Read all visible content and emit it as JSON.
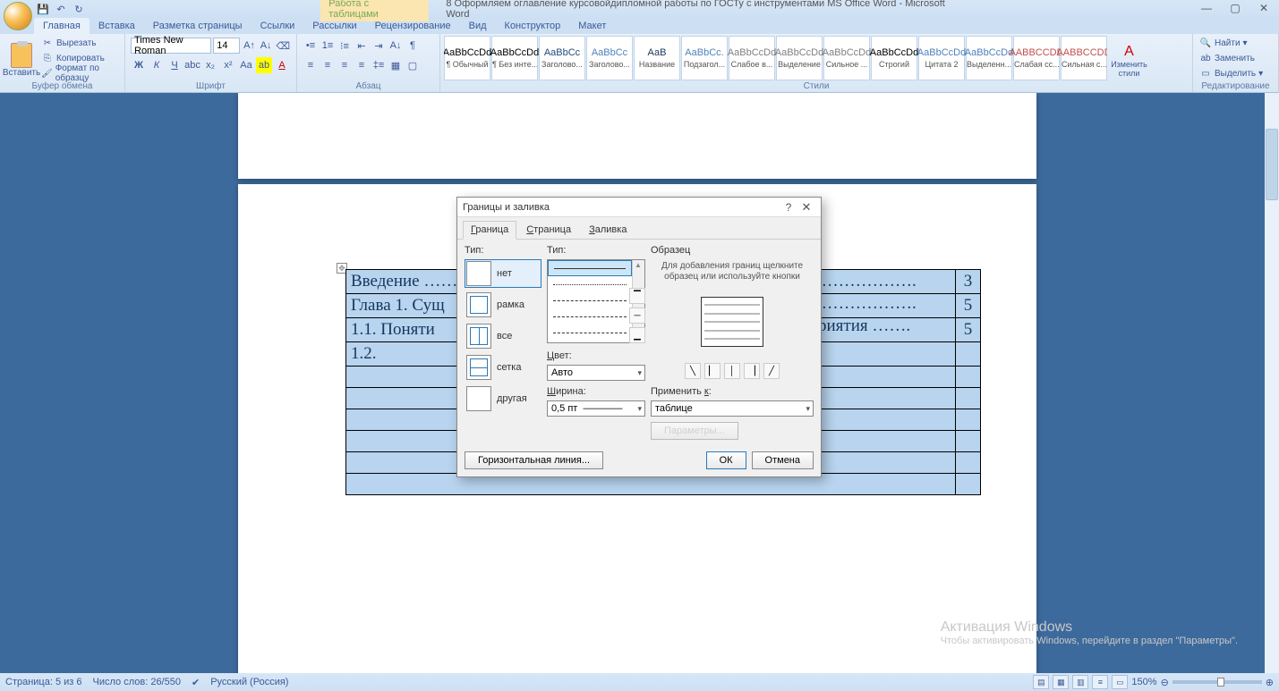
{
  "window": {
    "context_tab": "Работа с таблицами",
    "doc_title": "8 Оформляем оглавление курсовойдипломной работы по ГОСТу с инструментами MS Office Word - Microsoft Word"
  },
  "tabs": {
    "home": "Главная",
    "insert": "Вставка",
    "layout": "Разметка страницы",
    "refs": "Ссылки",
    "mail": "Рассылки",
    "review": "Рецензирование",
    "view": "Вид",
    "design": "Конструктор",
    "table_layout": "Макет"
  },
  "ribbon": {
    "paste": "Вставить",
    "cut": "Вырезать",
    "copy": "Копировать",
    "format_painter": "Формат по образцу",
    "clipboard_group": "Буфер обмена",
    "font_name": "Times New Roman",
    "font_size": "14",
    "font_group": "Шрифт",
    "para_group": "Абзац",
    "styles_group": "Стили",
    "change_styles": "Изменить стили",
    "find": "Найти",
    "replace": "Заменить",
    "select": "Выделить",
    "editing_group": "Редактирование",
    "styles": [
      {
        "preview": "AaBbCcDd",
        "name": "¶ Обычный",
        "color": "#000"
      },
      {
        "preview": "AaBbCcDd",
        "name": "¶ Без инте...",
        "color": "#000"
      },
      {
        "preview": "AaBbCc",
        "name": "Заголово...",
        "color": "#1f497d"
      },
      {
        "preview": "AaBbCc",
        "name": "Заголово...",
        "color": "#4f81bd"
      },
      {
        "preview": "АаВ",
        "name": "Название",
        "color": "#17365d"
      },
      {
        "preview": "AaBbCc.",
        "name": "Подзагол...",
        "color": "#4f81bd"
      },
      {
        "preview": "AaBbCcDd",
        "name": "Слабое в...",
        "color": "#808080"
      },
      {
        "preview": "AaBbCcDd",
        "name": "Выделение",
        "color": "#808080"
      },
      {
        "preview": "AaBbCcDd",
        "name": "Сильное ...",
        "color": "#808080"
      },
      {
        "preview": "AaBbCcDd",
        "name": "Строгий",
        "color": "#000"
      },
      {
        "preview": "AaBbCcDd",
        "name": "Цитата 2",
        "color": "#4f81bd"
      },
      {
        "preview": "AaBbCcDd",
        "name": "Выделенн...",
        "color": "#4f81bd"
      },
      {
        "preview": "AABBCCDD",
        "name": "Слабая сс...",
        "color": "#c0504d"
      },
      {
        "preview": "AABBCCDD",
        "name": "Сильная с...",
        "color": "#c0504d"
      }
    ]
  },
  "document": {
    "rows": [
      {
        "text": "Введение ………………………………",
        "tail": "………………….",
        "page": "3"
      },
      {
        "text": "Глава 1. Сущ",
        "tail": "………………….",
        "page": "5"
      },
      {
        "text": "1.1.    Поняти",
        "tail": "едприятия …….",
        "page": "5"
      },
      {
        "text": "1.2.",
        "tail": "",
        "page": ""
      }
    ]
  },
  "dialog": {
    "title": "Границы и заливка",
    "tab_border": "Граница",
    "tab_page": "Страница",
    "tab_fill": "Заливка",
    "label_type": "Тип:",
    "label_linetype": "Тип:",
    "label_color": "Цвет:",
    "label_width": "Ширина:",
    "label_preview": "Образец",
    "preview_hint": "Для добавления границ щелкните образец или используйте кнопки",
    "label_apply": "Применить к:",
    "type_none": "нет",
    "type_box": "рамка",
    "type_all": "все",
    "type_grid": "сетка",
    "type_custom": "другая",
    "color_value": "Авто",
    "width_value": "0,5 пт",
    "apply_value": "таблице",
    "btn_options": "Параметры...",
    "btn_hline": "Горизонтальная линия...",
    "btn_ok": "ОК",
    "btn_cancel": "Отмена"
  },
  "statusbar": {
    "page": "Страница: 5 из 6",
    "words": "Число слов: 26/550",
    "lang": "Русский (Россия)",
    "zoom": "150%"
  },
  "watermark": {
    "title": "Активация Windows",
    "sub": "Чтобы активировать Windows, перейдите в раздел \"Параметры\"."
  }
}
